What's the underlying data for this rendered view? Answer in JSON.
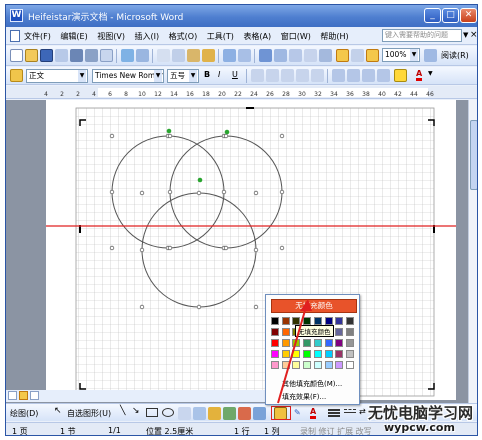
{
  "window": {
    "title": "Heifeistar演示文档 - Microsoft Word",
    "app_icon": "W",
    "minimize": "_",
    "maximize": "□",
    "close": "✕"
  },
  "menubar": {
    "items": [
      "文件(F)",
      "编辑(E)",
      "视图(V)",
      "插入(I)",
      "格式(O)",
      "工具(T)",
      "表格(A)",
      "窗口(W)",
      "帮助(H)"
    ],
    "help_placeholder": "键入需要帮助的问题",
    "close_doc": "×"
  },
  "toolbar": {
    "zoom": "100%",
    "reading": "阅读(R)",
    "style": "正文",
    "font": "Times New Roman",
    "size": "五号",
    "bold": "B",
    "italic": "I",
    "underline": "U",
    "font_color_letter": "A"
  },
  "ruler": {
    "marks": [
      "4",
      "2",
      "2",
      "4",
      "6",
      "8",
      "10",
      "12",
      "14",
      "16",
      "18",
      "20",
      "22",
      "24",
      "26",
      "28",
      "30",
      "32",
      "34",
      "36",
      "38",
      "40",
      "42",
      "44",
      "46"
    ]
  },
  "drawing_toolbar": {
    "draw": "绘图(D)",
    "autoshapes": "自选图形(U)"
  },
  "fill_menu": {
    "no_fill": "无填充颜色",
    "tooltip": "无填充颜色",
    "more_colors": "其他填充颜色(M)...",
    "fill_effects": "填充效果(F)...",
    "colors": [
      "#000000",
      "#993300",
      "#333300",
      "#003300",
      "#003366",
      "#000080",
      "#333399",
      "#333333",
      "#800000",
      "#ff6600",
      "#808000",
      "#008000",
      "#008080",
      "#0000ff",
      "#666699",
      "#808080",
      "#ff0000",
      "#ff9900",
      "#99cc00",
      "#339966",
      "#33cccc",
      "#3366ff",
      "#800080",
      "#969696",
      "#ff00ff",
      "#ffcc00",
      "#ffff00",
      "#00ff00",
      "#00ffff",
      "#00ccff",
      "#993366",
      "#c0c0c0",
      "#ff99cc",
      "#ffcc99",
      "#ffff99",
      "#ccffcc",
      "#ccffff",
      "#99ccff",
      "#cc99ff",
      "#ffffff"
    ]
  },
  "status": {
    "page": "1 页",
    "section": "1 节",
    "pages": "1/1",
    "position": "位置 2.5厘米",
    "line": "1 行",
    "column": "1 列",
    "modes": "录制  修订  扩展  改写"
  },
  "watermark": {
    "line1": "无忧电脑学习网",
    "line2": "wypcw.com"
  },
  "colors": {
    "accent_red": "#e02020",
    "nofill_orange": "#e8532a",
    "titlebar_blue": "#3f6fc4"
  }
}
